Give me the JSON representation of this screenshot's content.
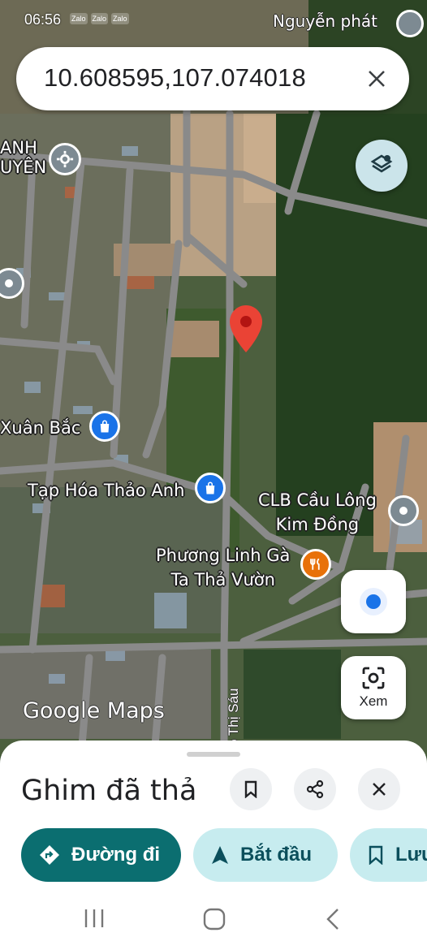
{
  "status_bar": {
    "time": "06:56",
    "apps": [
      "Zalo",
      "Zalo",
      "Zalo"
    ],
    "right_text": "Nguyễn phát"
  },
  "search": {
    "query": "10.608595,107.074018",
    "close_icon": "close-icon"
  },
  "map": {
    "labels": {
      "top_left": "ANH\nUYÊN",
      "xuan_bac": "Xuân Bắc",
      "tap_hoa": "Tạp Hóa Thảo Anh",
      "clb_line1": "CLB Cầu Lông",
      "clb_line2": "Kim Đồng",
      "phuong_line1": "Phương Linh Gà",
      "phuong_line2": "Ta Thả Vườn",
      "street": "ô Thị Sáu"
    },
    "logo": "Google Maps",
    "pin_color": "#ea4335"
  },
  "buttons": {
    "layers_icon": "layers-icon",
    "location_icon": "my-location-icon",
    "lens_label": "Xem"
  },
  "sheet": {
    "title": "Ghim đã thả",
    "actions": [
      "bookmark-icon",
      "share-icon",
      "close-icon"
    ],
    "chips": {
      "directions": "Đường đi",
      "start": "Bắt đầu",
      "save": "Lưu"
    }
  },
  "colors": {
    "primary_chip": "#0b6e70",
    "secondary_chip": "#c7ecef",
    "accent_blue": "#1a73e8"
  }
}
